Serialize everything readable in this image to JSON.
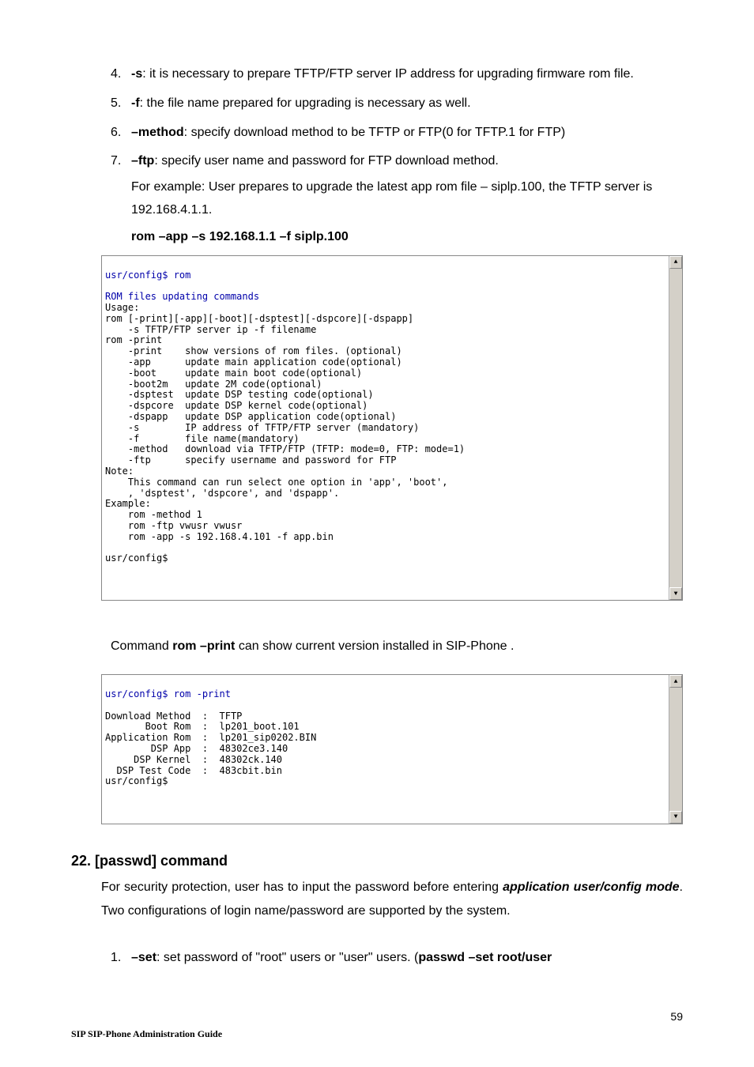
{
  "list_top": [
    {
      "num": "4.",
      "flag": "-s",
      "rest": ": it is necessary to prepare TFTP/FTP server IP address for upgrading firmware rom file."
    },
    {
      "num": "5.",
      "flag": "-f",
      "rest": ": the file name prepared for upgrading is necessary as well."
    },
    {
      "num": "6.",
      "flag": "–method",
      "rest": ": specify download method to be TFTP or FTP(0 for TFTP.1 for FTP)"
    },
    {
      "num": "7.",
      "flag": "–ftp",
      "rest": ": specify user name and password for FTP download method."
    }
  ],
  "example_line": "For example: User prepares to upgrade the latest app rom file – siplp.100, the TFTP server is 192.168.4.1.1.",
  "rom_cmd": "rom –app –s 192.168.1.1 –f siplp.100",
  "terminal1": {
    "line1": "usr/config$ rom",
    "line2": "ROM files updating commands",
    "body": "Usage:\nrom [-print][-app][-boot][-dsptest][-dspcore][-dspapp]\n    -s TFTP/FTP server ip -f filename\nrom -print\n    -print    show versions of rom files. (optional)\n    -app      update main application code(optional)\n    -boot     update main boot code(optional)\n    -boot2m   update 2M code(optional)\n    -dsptest  update DSP testing code(optional)\n    -dspcore  update DSP kernel code(optional)\n    -dspapp   update DSP application code(optional)\n    -s        IP address of TFTP/FTP server (mandatory)\n    -f        file name(mandatory)\n    -method   download via TFTP/FTP (TFTP: mode=0, FTP: mode=1)\n    -ftp      specify username and password for FTP\nNote:\n    This command can run select one option in 'app', 'boot',\n    , 'dsptest', 'dspcore', and 'dspapp'.\nExample:\n    rom -method 1\n    rom -ftp vwusr vwusr\n    rom -app -s 192.168.4.101 -f app.bin\n\nusr/config$\n"
  },
  "mid_para_pre": "Command ",
  "mid_para_bold": "rom –print",
  "mid_para_post": " can show current version installed in SIP-Phone .",
  "terminal2": {
    "line1": "usr/config$ rom -print",
    "body": "\nDownload Method  :  TFTP\n       Boot Rom  :  lp201_boot.101\nApplication Rom  :  lp201_sip0202.BIN\n        DSP App  :  48302ce3.140\n     DSP Kernel  :  48302ck.140\n  DSP Test Code  :  483cbit.bin\nusr/config$\n"
  },
  "section_head": "22. [passwd] command",
  "body_para_pre": "For security protection, user has to input the password before entering ",
  "body_para_bold": "application user/config mode",
  "body_para_post": ". Two configurations of login name/password are supported by the system.",
  "list_bottom": {
    "num": "1.",
    "flag": "–set",
    "mid": ": set password of \"root\" users or \"user\" users. (",
    "bold2": "passwd –set root/user"
  },
  "page_num": "59",
  "footer": "SIP SIP-Phone    Administration Guide",
  "glyph_up": "▲",
  "glyph_down": "▼"
}
